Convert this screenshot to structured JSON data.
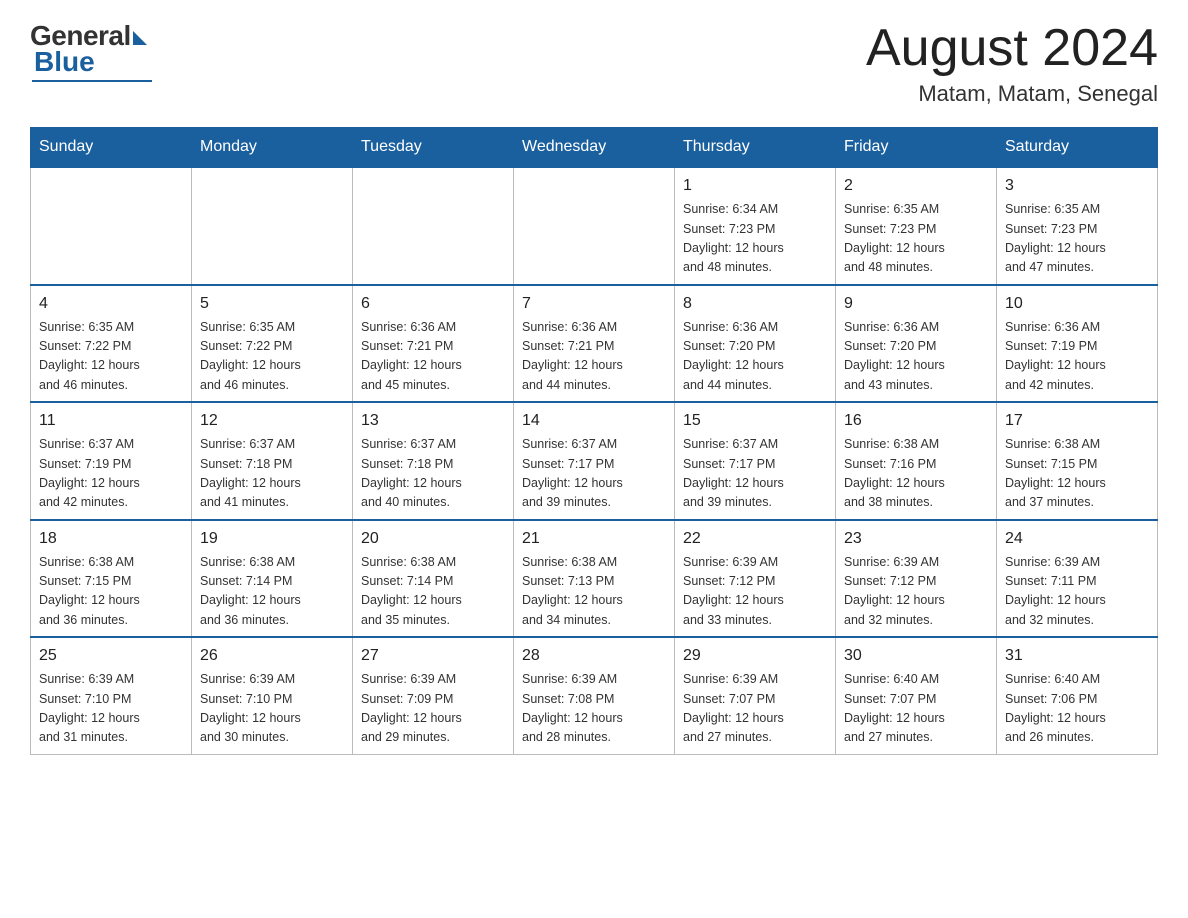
{
  "logo": {
    "general": "General",
    "blue": "Blue",
    "underline": "Blue"
  },
  "header": {
    "month_title": "August 2024",
    "location": "Matam, Matam, Senegal"
  },
  "weekdays": [
    "Sunday",
    "Monday",
    "Tuesday",
    "Wednesday",
    "Thursday",
    "Friday",
    "Saturday"
  ],
  "weeks": [
    {
      "days": [
        {
          "num": "",
          "info": ""
        },
        {
          "num": "",
          "info": ""
        },
        {
          "num": "",
          "info": ""
        },
        {
          "num": "",
          "info": ""
        },
        {
          "num": "1",
          "info": "Sunrise: 6:34 AM\nSunset: 7:23 PM\nDaylight: 12 hours\nand 48 minutes."
        },
        {
          "num": "2",
          "info": "Sunrise: 6:35 AM\nSunset: 7:23 PM\nDaylight: 12 hours\nand 48 minutes."
        },
        {
          "num": "3",
          "info": "Sunrise: 6:35 AM\nSunset: 7:23 PM\nDaylight: 12 hours\nand 47 minutes."
        }
      ]
    },
    {
      "days": [
        {
          "num": "4",
          "info": "Sunrise: 6:35 AM\nSunset: 7:22 PM\nDaylight: 12 hours\nand 46 minutes."
        },
        {
          "num": "5",
          "info": "Sunrise: 6:35 AM\nSunset: 7:22 PM\nDaylight: 12 hours\nand 46 minutes."
        },
        {
          "num": "6",
          "info": "Sunrise: 6:36 AM\nSunset: 7:21 PM\nDaylight: 12 hours\nand 45 minutes."
        },
        {
          "num": "7",
          "info": "Sunrise: 6:36 AM\nSunset: 7:21 PM\nDaylight: 12 hours\nand 44 minutes."
        },
        {
          "num": "8",
          "info": "Sunrise: 6:36 AM\nSunset: 7:20 PM\nDaylight: 12 hours\nand 44 minutes."
        },
        {
          "num": "9",
          "info": "Sunrise: 6:36 AM\nSunset: 7:20 PM\nDaylight: 12 hours\nand 43 minutes."
        },
        {
          "num": "10",
          "info": "Sunrise: 6:36 AM\nSunset: 7:19 PM\nDaylight: 12 hours\nand 42 minutes."
        }
      ]
    },
    {
      "days": [
        {
          "num": "11",
          "info": "Sunrise: 6:37 AM\nSunset: 7:19 PM\nDaylight: 12 hours\nand 42 minutes."
        },
        {
          "num": "12",
          "info": "Sunrise: 6:37 AM\nSunset: 7:18 PM\nDaylight: 12 hours\nand 41 minutes."
        },
        {
          "num": "13",
          "info": "Sunrise: 6:37 AM\nSunset: 7:18 PM\nDaylight: 12 hours\nand 40 minutes."
        },
        {
          "num": "14",
          "info": "Sunrise: 6:37 AM\nSunset: 7:17 PM\nDaylight: 12 hours\nand 39 minutes."
        },
        {
          "num": "15",
          "info": "Sunrise: 6:37 AM\nSunset: 7:17 PM\nDaylight: 12 hours\nand 39 minutes."
        },
        {
          "num": "16",
          "info": "Sunrise: 6:38 AM\nSunset: 7:16 PM\nDaylight: 12 hours\nand 38 minutes."
        },
        {
          "num": "17",
          "info": "Sunrise: 6:38 AM\nSunset: 7:15 PM\nDaylight: 12 hours\nand 37 minutes."
        }
      ]
    },
    {
      "days": [
        {
          "num": "18",
          "info": "Sunrise: 6:38 AM\nSunset: 7:15 PM\nDaylight: 12 hours\nand 36 minutes."
        },
        {
          "num": "19",
          "info": "Sunrise: 6:38 AM\nSunset: 7:14 PM\nDaylight: 12 hours\nand 36 minutes."
        },
        {
          "num": "20",
          "info": "Sunrise: 6:38 AM\nSunset: 7:14 PM\nDaylight: 12 hours\nand 35 minutes."
        },
        {
          "num": "21",
          "info": "Sunrise: 6:38 AM\nSunset: 7:13 PM\nDaylight: 12 hours\nand 34 minutes."
        },
        {
          "num": "22",
          "info": "Sunrise: 6:39 AM\nSunset: 7:12 PM\nDaylight: 12 hours\nand 33 minutes."
        },
        {
          "num": "23",
          "info": "Sunrise: 6:39 AM\nSunset: 7:12 PM\nDaylight: 12 hours\nand 32 minutes."
        },
        {
          "num": "24",
          "info": "Sunrise: 6:39 AM\nSunset: 7:11 PM\nDaylight: 12 hours\nand 32 minutes."
        }
      ]
    },
    {
      "days": [
        {
          "num": "25",
          "info": "Sunrise: 6:39 AM\nSunset: 7:10 PM\nDaylight: 12 hours\nand 31 minutes."
        },
        {
          "num": "26",
          "info": "Sunrise: 6:39 AM\nSunset: 7:10 PM\nDaylight: 12 hours\nand 30 minutes."
        },
        {
          "num": "27",
          "info": "Sunrise: 6:39 AM\nSunset: 7:09 PM\nDaylight: 12 hours\nand 29 minutes."
        },
        {
          "num": "28",
          "info": "Sunrise: 6:39 AM\nSunset: 7:08 PM\nDaylight: 12 hours\nand 28 minutes."
        },
        {
          "num": "29",
          "info": "Sunrise: 6:39 AM\nSunset: 7:07 PM\nDaylight: 12 hours\nand 27 minutes."
        },
        {
          "num": "30",
          "info": "Sunrise: 6:40 AM\nSunset: 7:07 PM\nDaylight: 12 hours\nand 27 minutes."
        },
        {
          "num": "31",
          "info": "Sunrise: 6:40 AM\nSunset: 7:06 PM\nDaylight: 12 hours\nand 26 minutes."
        }
      ]
    }
  ]
}
